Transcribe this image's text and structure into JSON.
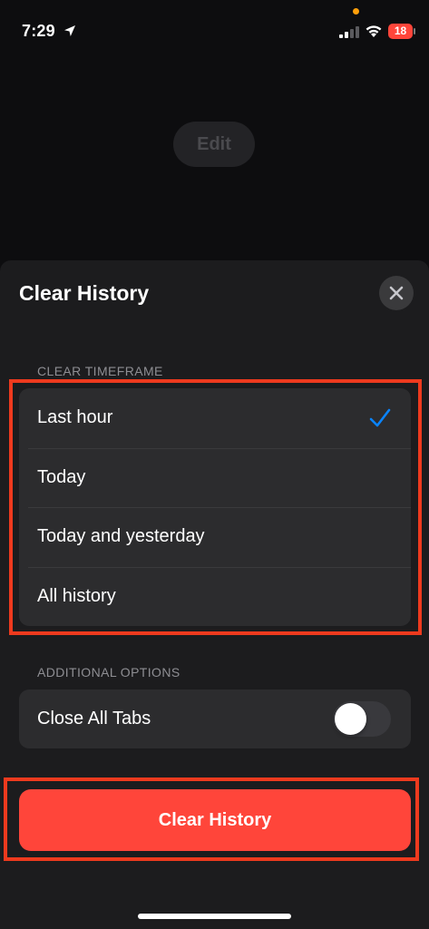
{
  "status_bar": {
    "time": "7:29",
    "battery": "18",
    "icons": [
      "location-arrow-icon",
      "cellular-signal-icon",
      "wifi-icon",
      "battery-icon"
    ],
    "battery_color": "#ff453a"
  },
  "background": {
    "edit_label": "Edit"
  },
  "sheet": {
    "title": "Clear History",
    "close_icon": "close-icon",
    "timeframe": {
      "label": "CLEAR TIMEFRAME",
      "options": [
        {
          "label": "Last hour",
          "selected": true
        },
        {
          "label": "Today",
          "selected": false
        },
        {
          "label": "Today and yesterday",
          "selected": false
        },
        {
          "label": "All history",
          "selected": false
        }
      ],
      "check_color": "#0a84ff"
    },
    "additional": {
      "label": "ADDITIONAL OPTIONS",
      "close_all_tabs": {
        "label": "Close All Tabs",
        "on": false
      }
    },
    "clear_button": {
      "label": "Clear History",
      "color": "#ff453a"
    }
  },
  "annotation_color": "#ee3a1e"
}
